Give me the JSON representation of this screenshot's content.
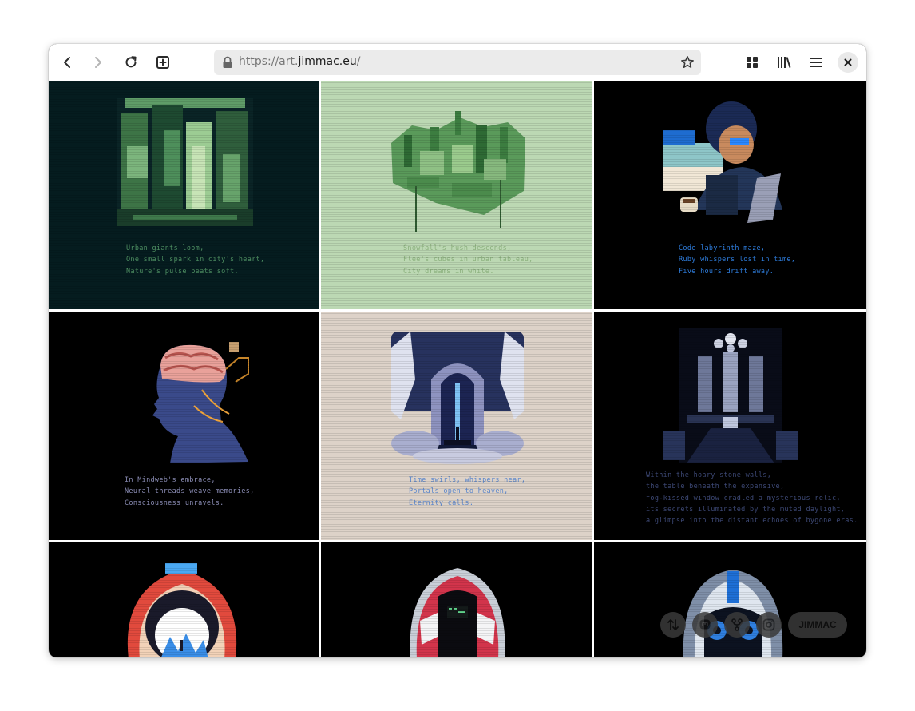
{
  "browser": {
    "url_prefix": "https://art.",
    "url_host": "jimmac.eu",
    "url_suffix": "/"
  },
  "gallery": {
    "tiles": [
      {
        "poem": [
          "Urban giants loom,",
          "One small spark in city's heart,",
          "Nature's pulse beats soft."
        ],
        "bg": "#051c1f",
        "text_color": "#4e8f62"
      },
      {
        "poem": [
          "Snowfall's hush descends,",
          "Flee's cubes in urban tableau,",
          "City dreams in white."
        ],
        "bg": "#bcd8b3",
        "text_color": "#8bb07d"
      },
      {
        "poem": [
          "Code labyrinth maze,",
          "Ruby whispers lost in time,",
          "Five hours drift away."
        ],
        "bg": "#000000",
        "text_color": "#2f7fe0"
      },
      {
        "poem": [
          "In Mindweb's embrace,",
          "Neural threads weave memories,",
          "Consciousness unravels."
        ],
        "bg": "#000000",
        "text_color": "#8d8fb8"
      },
      {
        "poem": [
          "Time swirls, whispers near,",
          "Portals open to heaven,",
          "Eternity calls."
        ],
        "bg": "#ddd2c8",
        "text_color": "#5a86cc"
      },
      {
        "poem": [
          "Within the hoary stone walls,",
          "the table beneath the expansive,",
          "fog-kissed window cradled a mysterious relic,",
          "its secrets illuminated by the muted daylight,",
          "a glimpse into the distant echoes of bygone eras."
        ],
        "bg": "#000000",
        "text_color": "#3e4a78"
      },
      {
        "poem": [],
        "bg": "#000000",
        "text_color": "#ffffff"
      },
      {
        "poem": [],
        "bg": "#000000",
        "text_color": "#ffffff"
      },
      {
        "poem": [],
        "bg": "#000000",
        "text_color": "#ffffff"
      }
    ]
  },
  "social": {
    "name_label": "JIMMAC",
    "icons": [
      "sort-arrows-icon",
      "mastodon-icon",
      "git-fork-icon",
      "instagram-icon"
    ]
  }
}
